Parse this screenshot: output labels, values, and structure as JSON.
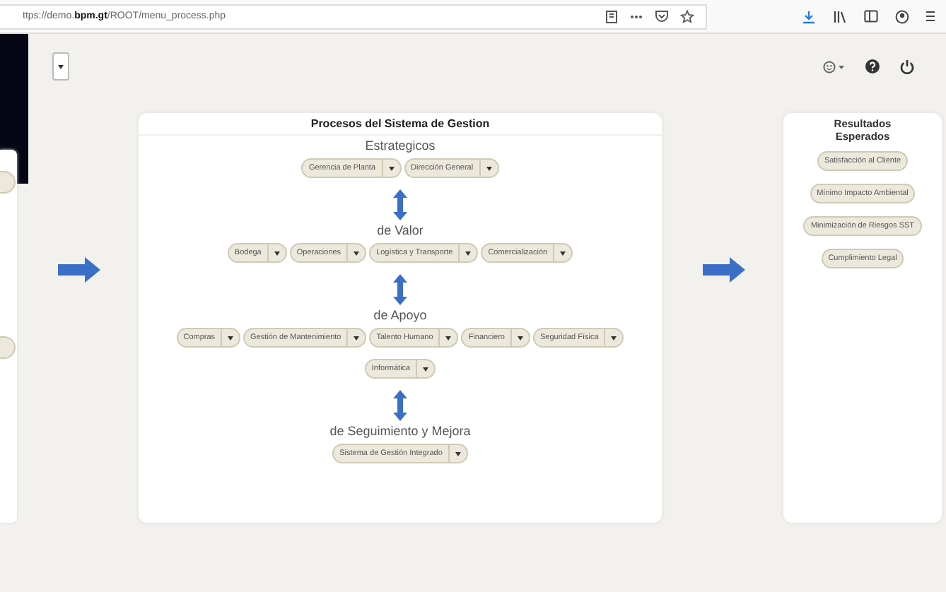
{
  "browser": {
    "url": "ttps://demo.**bpm.gt**/ROOT/menu_process.php"
  },
  "process_map": {
    "title": "Procesos del Sistema de Gestion",
    "sections": [
      {
        "heading": "Estrategicos",
        "items": [
          "Gerencia de Planta",
          "Dirección General"
        ]
      },
      {
        "heading": "de Valor",
        "items": [
          "Bodega",
          "Operaciones",
          "Logística y Transporte",
          "Comercialización"
        ]
      },
      {
        "heading": "de Apoyo",
        "items": [
          "Compras",
          "Gestión de Mantenimiento",
          "Talento Humano",
          "Financiero",
          "Seguridad Física",
          "Informática"
        ]
      },
      {
        "heading": "de Seguimiento y Mejora",
        "items": [
          "Sistema de Gestión Integrado"
        ]
      }
    ]
  },
  "results": {
    "title": "Resultados Esperados",
    "items": [
      "Satisfacción al Cliente",
      "Mínimo Impacto Ambiental",
      "Minimización de Riesgos SST",
      "Cumplimiento Legal"
    ]
  }
}
